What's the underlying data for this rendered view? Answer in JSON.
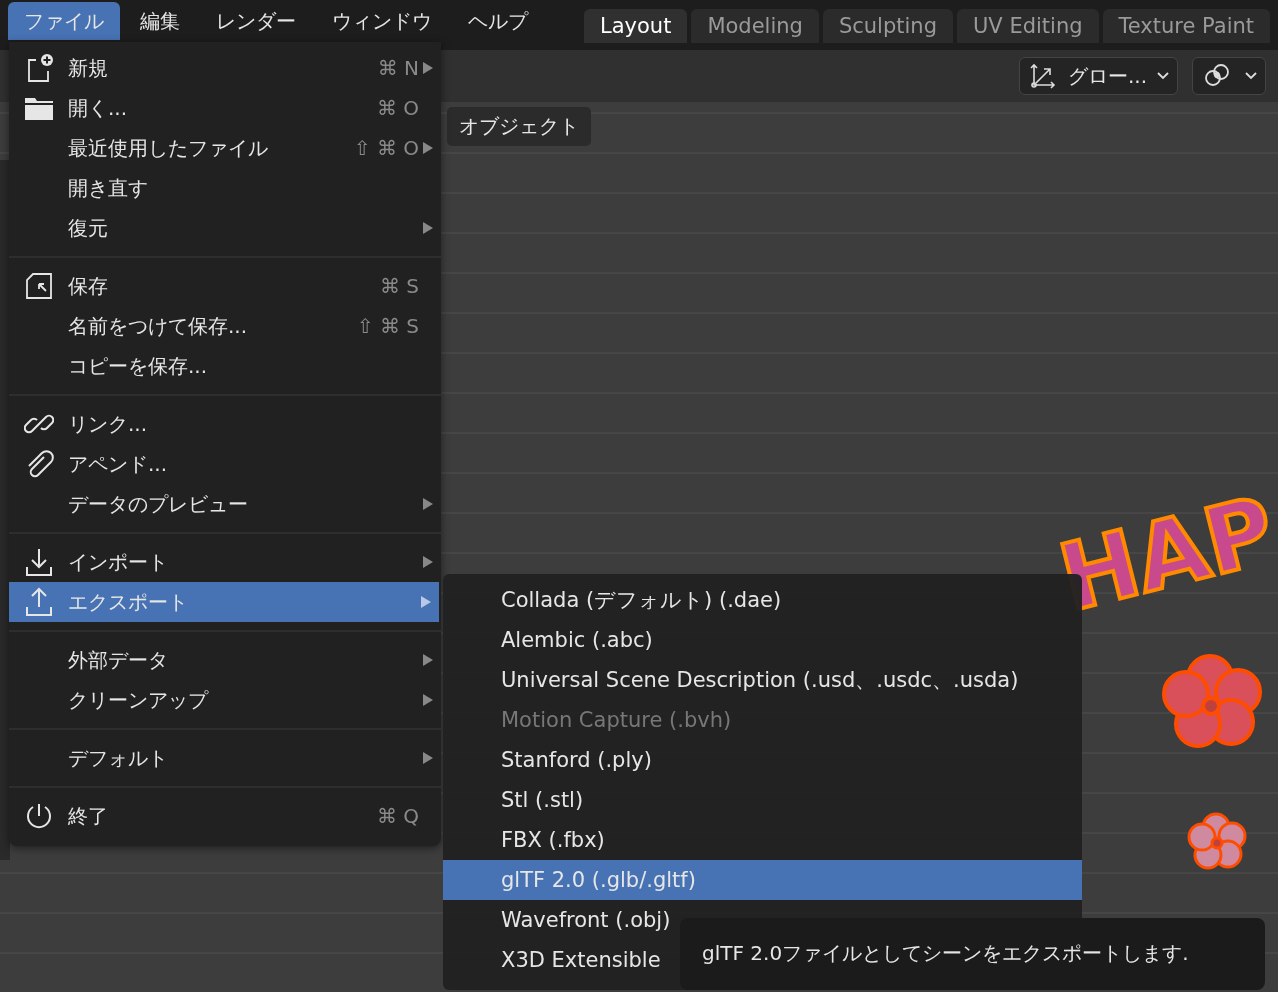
{
  "menubar": [
    {
      "label": "ファイル",
      "selected": true
    },
    {
      "label": "編集",
      "selected": false
    },
    {
      "label": "レンダー",
      "selected": false
    },
    {
      "label": "ウィンドウ",
      "selected": false
    },
    {
      "label": "ヘルプ",
      "selected": false
    }
  ],
  "workspace_tabs": [
    {
      "label": "Layout",
      "selected": true
    },
    {
      "label": "Modeling",
      "selected": false
    },
    {
      "label": "Sculpting",
      "selected": false
    },
    {
      "label": "UV Editing",
      "selected": false
    },
    {
      "label": "Texture Paint",
      "selected": false
    }
  ],
  "viewport": {
    "transform_orientation": "グロー...",
    "object_menu": "オブジェクト",
    "scene_text": "HAP"
  },
  "file_menu": {
    "groups": [
      [
        {
          "label": "新規",
          "shortcut": "⌘ N",
          "kind": "new",
          "submenu": true,
          "selected": false
        },
        {
          "label": "開く...",
          "shortcut": "⌘ O",
          "kind": "folder",
          "submenu": false,
          "selected": false
        },
        {
          "label": "最近使用したファイル",
          "shortcut": "⇧ ⌘ O",
          "submenu": true,
          "selected": false
        },
        {
          "label": "開き直す",
          "submenu": false,
          "selected": false
        },
        {
          "label": "復元",
          "submenu": true,
          "selected": false
        }
      ],
      [
        {
          "label": "保存",
          "shortcut": "⌘ S",
          "kind": "save",
          "submenu": false,
          "selected": false
        },
        {
          "label": "名前をつけて保存...",
          "shortcut": "⇧ ⌘ S",
          "submenu": false,
          "selected": false
        },
        {
          "label": "コピーを保存...",
          "submenu": false,
          "selected": false
        }
      ],
      [
        {
          "label": "リンク...",
          "kind": "link",
          "submenu": false,
          "selected": false
        },
        {
          "label": "アペンド...",
          "kind": "append",
          "submenu": false,
          "selected": false
        },
        {
          "label": "データのプレビュー",
          "submenu": true,
          "selected": false
        }
      ],
      [
        {
          "label": "インポート",
          "kind": "import",
          "submenu": true,
          "selected": false
        },
        {
          "label": "エクスポート",
          "kind": "export",
          "submenu": true,
          "selected": true
        }
      ],
      [
        {
          "label": "外部データ",
          "submenu": true,
          "selected": false
        },
        {
          "label": "クリーンアップ",
          "submenu": true,
          "selected": false
        }
      ],
      [
        {
          "label": "デフォルト",
          "submenu": true,
          "selected": false
        }
      ],
      [
        {
          "label": "終了",
          "shortcut": "⌘ Q",
          "kind": "quit",
          "submenu": false,
          "selected": false
        }
      ]
    ]
  },
  "export_submenu": [
    {
      "label": "Collada (デフォルト) (.dae)",
      "disabled": false,
      "selected": false
    },
    {
      "label": "Alembic (.abc)",
      "disabled": false,
      "selected": false
    },
    {
      "label": "Universal Scene Description (.usd、.usdc、.usda)",
      "disabled": false,
      "selected": false
    },
    {
      "label": "Motion Capture (.bvh)",
      "disabled": true,
      "selected": false
    },
    {
      "label": "Stanford (.ply)",
      "disabled": false,
      "selected": false
    },
    {
      "label": "Stl (.stl)",
      "disabled": false,
      "selected": false
    },
    {
      "label": "FBX (.fbx)",
      "disabled": false,
      "selected": false
    },
    {
      "label": "glTF 2.0 (.glb/.gltf)",
      "disabled": false,
      "selected": true
    },
    {
      "label": "Wavefront (.obj)",
      "disabled": false,
      "selected": false
    },
    {
      "label": "X3D Extensible",
      "disabled": false,
      "selected": false
    }
  ],
  "tooltip": "glTF 2.0ファイルとしてシーンをエクスポートします."
}
